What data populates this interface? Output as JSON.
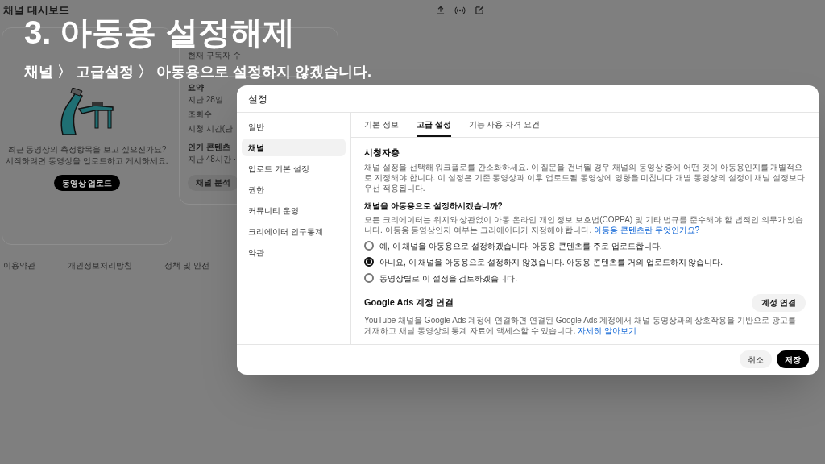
{
  "dashboard": {
    "title": "채널 대시보드",
    "upload_card": {
      "message": "최근 동영상의 측정항목을 보고 싶으신가요?\n시작하려면 동영상을 업로드하고 게시하세요.",
      "button": "동영상 업로드"
    },
    "analytics_card": {
      "subscribers_label": "현재 구독자 수",
      "summary_title": "요약",
      "summary_period": "지난 28일",
      "metrics": [
        "조회수",
        "시청 시간(단"
      ],
      "top_content_title": "인기 콘텐츠",
      "top_content_period": "지난 48시간 ·",
      "button": "채널 분석"
    },
    "footer_links": [
      "이용약관",
      "개인정보처리방침",
      "정책 및 안전"
    ]
  },
  "overlay": {
    "title": "3. 아동용 설정해제",
    "subtitle": "채널 〉 고급설정 〉 아동용으로 설정하지 않겠습니다."
  },
  "dialog": {
    "title": "설정",
    "nav": [
      {
        "label": "일반",
        "selected": false
      },
      {
        "label": "채널",
        "selected": true
      },
      {
        "label": "업로드 기본 설정",
        "selected": false
      },
      {
        "label": "권한",
        "selected": false
      },
      {
        "label": "커뮤니티 운영",
        "selected": false
      },
      {
        "label": "크리에이터 인구통계",
        "selected": false
      },
      {
        "label": "약관",
        "selected": false
      }
    ],
    "tabs": [
      {
        "label": "기본 정보",
        "selected": false
      },
      {
        "label": "고급 설정",
        "selected": true
      },
      {
        "label": "기능 사용 자격 요건",
        "selected": false
      }
    ],
    "audience": {
      "title": "시청자층",
      "description": "채널 설정을 선택해 워크플로를 간소화하세요. 이 질문을 건너뛸 경우 채널의 동영상 중에 어떤 것이 아동용인지를 개별적으로 지정해야 합니다. 이 설정은 기존 동영상과 이후 업로드될 동영상에 영향을 미칩니다 개별 동영상의 설정이 채널 설정보다 우선 적용됩니다.",
      "question": "채널을 아동용으로 설정하시겠습니까?",
      "notice": "모든 크리에이터는 위치와 상관없이 아동 온라인 개인 정보 보호법(COPPA) 및 기타 법규를 준수해야 할 법적인 의무가 있습니다. 아동용 동영상인지 여부는 크리에이터가 지정해야 합니다.",
      "notice_link": "아동용 콘텐츠란 무엇인가요?",
      "options": [
        {
          "label": "예, 이 채널을 아동용으로 설정하겠습니다. 아동용 콘텐츠를 주로 업로드합니다.",
          "selected": false
        },
        {
          "label": "아니요, 이 채널을 아동용으로 설정하지 않겠습니다. 아동용 콘텐츠를 거의 업로드하지 않습니다.",
          "selected": true
        },
        {
          "label": "동영상별로 이 설정을 검토하겠습니다.",
          "selected": false
        }
      ]
    },
    "ads": {
      "title": "Google Ads 계정 연결",
      "button": "계정 연결",
      "description": "YouTube 채널을 Google Ads 계정에 연결하면 연결된 Google Ads 계정에서 채널 동영상과의 상호작용을 기반으로 광고를 게재하고 채널 동영상의 통계 자료에 액세스할 수 있습니다.",
      "link": "자세히 알아보기"
    },
    "buttons": {
      "cancel": "취소",
      "save": "저장"
    }
  }
}
